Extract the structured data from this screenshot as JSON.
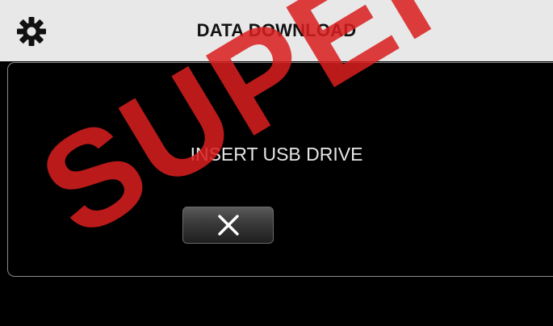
{
  "header": {
    "title": "DATA DOWNLOAD",
    "settings_icon": "gear-icon"
  },
  "dialog": {
    "message": "INSERT USB DRIVE",
    "cancel_icon": "close-icon"
  },
  "watermark": {
    "text": "SUPEI",
    "color": "#d81e1e"
  },
  "colors": {
    "header_bg": "#e8e8e8",
    "screen_bg": "#000000",
    "text_light": "#e6e6e6"
  }
}
